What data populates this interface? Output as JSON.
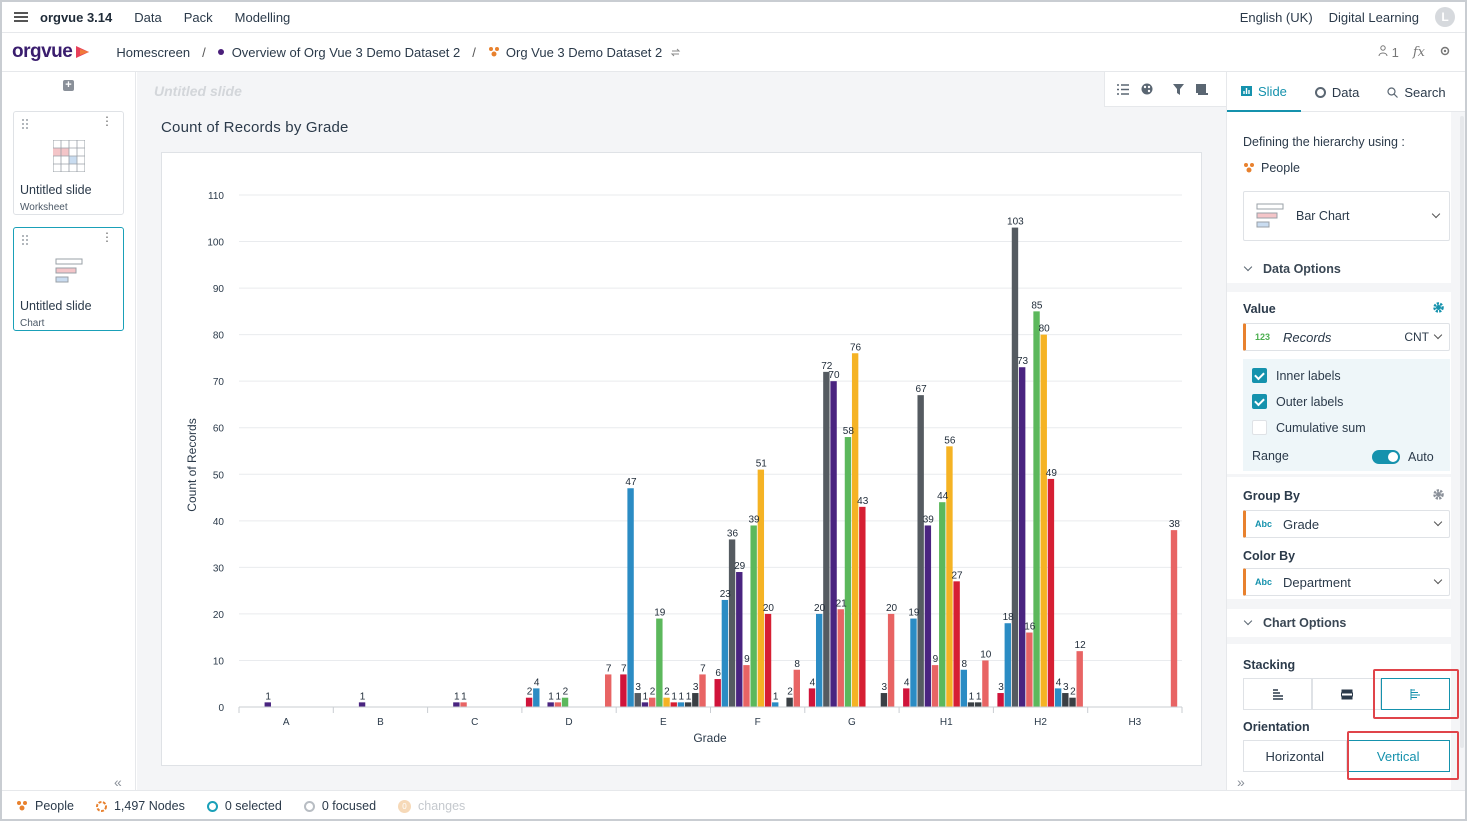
{
  "menubar": {
    "app_version": "orgvue 3.14",
    "items": [
      "Data",
      "Pack",
      "Modelling"
    ],
    "language": "English (UK)",
    "org": "Digital Learning",
    "avatar_initial": "L"
  },
  "header": {
    "logo_text": "orgvue",
    "crumbs": [
      "Homescreen",
      "Overview of Org Vue 3 Demo Dataset 2",
      "Org Vue 3 Demo Dataset 2"
    ],
    "user_count": "1",
    "fx": "fx"
  },
  "slides": [
    {
      "title": "Untitled slide",
      "type": "Worksheet"
    },
    {
      "title": "Untitled slide",
      "type": "Chart"
    }
  ],
  "main": {
    "slide_title_placeholder": "Untitled slide",
    "chart_title": "Count of Records by Grade"
  },
  "chart_data": {
    "type": "bar",
    "xlabel": "Grade",
    "ylabel": "Count of Records",
    "ylim": [
      0,
      110
    ],
    "yticks": [
      0,
      10,
      20,
      30,
      40,
      50,
      60,
      70,
      80,
      90,
      100,
      110
    ],
    "categories": [
      "A",
      "B",
      "C",
      "D",
      "E",
      "F",
      "G",
      "H1",
      "H2",
      "H3"
    ],
    "palette": [
      "#d0143a",
      "#2b8cc4",
      "#555b61",
      "#4a2480",
      "#e86464",
      "#5cb85c",
      "#f5b324",
      "#d61f33",
      "#1e5aa8",
      "#2e6bb5"
    ],
    "series_values": [
      [
        0,
        0,
        0,
        2,
        7,
        6,
        4,
        4,
        3,
        0
      ],
      [
        0,
        0,
        0,
        4,
        47,
        23,
        20,
        19,
        18,
        0
      ],
      [
        0,
        0,
        0,
        0,
        3,
        36,
        72,
        67,
        103,
        0
      ],
      [
        1,
        1,
        1,
        1,
        1,
        29,
        70,
        39,
        73,
        0
      ],
      [
        0,
        0,
        1,
        1,
        2,
        9,
        21,
        9,
        16,
        0
      ],
      [
        0,
        0,
        0,
        2,
        19,
        39,
        58,
        44,
        85,
        0
      ],
      [
        0,
        0,
        0,
        0,
        2,
        51,
        76,
        56,
        80,
        0
      ],
      [
        0,
        0,
        0,
        0,
        1,
        20,
        43,
        27,
        49,
        0
      ],
      [
        0,
        0,
        0,
        0,
        1,
        1,
        0,
        8,
        4,
        0
      ],
      [
        0,
        0,
        0,
        0,
        1,
        0,
        0,
        1,
        3,
        0
      ],
      [
        0,
        0,
        0,
        0,
        3,
        2,
        3,
        1,
        2,
        0
      ],
      [
        0,
        0,
        0,
        7,
        7,
        8,
        20,
        10,
        12,
        38
      ]
    ],
    "series_colors": [
      "#d0143a",
      "#2b8cc4",
      "#555b61",
      "#4a2480",
      "#e86464",
      "#5cb85c",
      "#f5b324",
      "#d61f33",
      "#2b8cc4",
      "#3a3f44",
      "#3a3f44",
      "#e86464"
    ]
  },
  "tabs": [
    "Slide",
    "Data",
    "Search"
  ],
  "panel": {
    "hierarchy_label": "Defining the hierarchy using :",
    "hierarchy_value": "People",
    "visual_type": "Bar Chart",
    "data_options": "Data Options",
    "value_label": "Value",
    "value_field": "Records",
    "value_tag": "123",
    "value_agg": "CNT",
    "inner_labels": "Inner labels",
    "outer_labels": "Outer labels",
    "cumulative_sum": "Cumulative sum",
    "range_label": "Range",
    "range_value": "Auto",
    "group_by_label": "Group By",
    "group_by_value": "Grade",
    "color_by_label": "Color By",
    "color_by_value": "Department",
    "abc_tag": "Abc",
    "chart_options": "Chart Options",
    "stacking_label": "Stacking",
    "orientation_label": "Orientation",
    "orientation_horizontal": "Horizontal",
    "orientation_vertical": "Vertical"
  },
  "status": {
    "people": "People",
    "nodes": "1,497 Nodes",
    "selected": "0 selected",
    "focused": "0 focused",
    "changes_count": "0",
    "changes": "changes"
  },
  "colors": {
    "accent": "#1592ad",
    "brand": "#3a1d6e",
    "highlight": "#e0444a",
    "people_icon": "#e8812e"
  }
}
